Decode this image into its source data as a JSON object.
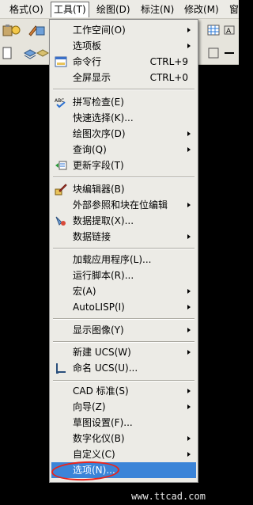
{
  "menubar": {
    "items": [
      "格式(O)",
      "工具(T)",
      "绘图(D)",
      "标注(N)",
      "修改(M)",
      "窗"
    ],
    "active_index": 1
  },
  "menu": {
    "items": [
      {
        "label": "工作空间(O)",
        "submenu": true
      },
      {
        "label": "选项板",
        "submenu": true
      },
      {
        "label": "命令行",
        "shortcut": "CTRL+9",
        "icon": "command-line-icon"
      },
      {
        "label": "全屏显示",
        "shortcut": "CTRL+0"
      },
      {
        "label": "拼写检查(E)",
        "icon": "spell-check-icon"
      },
      {
        "label": "快速选择(K)..."
      },
      {
        "label": "绘图次序(D)",
        "submenu": true
      },
      {
        "label": "查询(Q)",
        "submenu": true
      },
      {
        "label": "更新字段(T)",
        "icon": "update-field-icon"
      },
      {
        "label": "块编辑器(B)",
        "icon": "block-editor-icon"
      },
      {
        "label": "外部参照和块在位编辑",
        "submenu": true
      },
      {
        "label": "数据提取(X)...",
        "icon": "data-extraction-icon"
      },
      {
        "label": "数据链接",
        "submenu": true
      },
      {
        "label": "加载应用程序(L)..."
      },
      {
        "label": "运行脚本(R)..."
      },
      {
        "label": "宏(A)",
        "submenu": true
      },
      {
        "label": "AutoLISP(I)",
        "submenu": true
      },
      {
        "label": "显示图像(Y)",
        "submenu": true
      },
      {
        "label": "新建 UCS(W)",
        "submenu": true
      },
      {
        "label": "命名 UCS(U)...",
        "icon": "named-ucs-icon"
      },
      {
        "label": "CAD 标准(S)",
        "submenu": true
      },
      {
        "label": "向导(Z)",
        "submenu": true
      },
      {
        "label": "草图设置(F)..."
      },
      {
        "label": "数字化仪(B)",
        "submenu": true
      },
      {
        "label": "自定义(C)",
        "submenu": true
      },
      {
        "label": "选项(N)...",
        "selected": true
      }
    ]
  },
  "watermark": "www.ttcad.com",
  "colors": {
    "selection": "#3b84d8",
    "highlight_ring": "#e8241c",
    "menu_bg": "#ecebe6"
  }
}
